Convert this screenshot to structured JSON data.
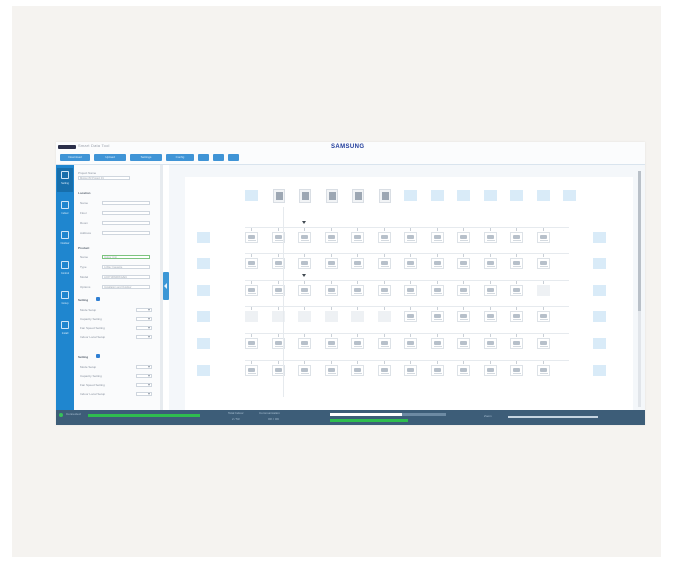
{
  "header": {
    "logo_text": "Smart Data Tool",
    "brand": "SAMSUNG",
    "toolbar": [
      {
        "label": "Download",
        "w": 30
      },
      {
        "label": "Upload",
        "w": 32
      },
      {
        "label": "Settings",
        "w": 32
      },
      {
        "label": "Config",
        "w": 28
      },
      {
        "label": "",
        "w": 11
      },
      {
        "label": "",
        "w": 11
      },
      {
        "label": "",
        "w": 11
      }
    ]
  },
  "nav": {
    "items": [
      {
        "label": "Setting"
      },
      {
        "label": "Indoor"
      },
      {
        "label": "Outdoor"
      },
      {
        "label": "Control"
      },
      {
        "label": "Group"
      },
      {
        "label": "Install"
      }
    ]
  },
  "panel": {
    "project_label": "Project Name",
    "project_value": "Motion 83 Project 01",
    "location_header": "Location",
    "location_fields": [
      "Name",
      "Floor",
      "Room",
      "Address"
    ],
    "product_header": "Product",
    "product_fields": [
      {
        "label": "Name",
        "value": "Indoor Unit"
      },
      {
        "label": "Type",
        "value": "4-Way Cassette"
      },
      {
        "label": "Model",
        "value": "AC071RN4DKG/EU"
      },
      {
        "label": "Options",
        "value": "Installation and Outdoor"
      }
    ],
    "setting1_header": "Setting",
    "setting1_fields": [
      "Mode Setup",
      "Capacity Setting",
      "Fan Speed Setting",
      "Indoor Local Setup"
    ],
    "setting2_header": "Setting",
    "setting2_fields": [
      "Mode Setup",
      "Capacity Setting",
      "Fan Speed Setting",
      "Indoor Local Setup"
    ]
  },
  "status": {
    "connection": "Connected",
    "field_a_label": "Total Indoor",
    "field_a_value": "2 / 53",
    "field_b_label": "Communication",
    "field_b_value": "OK / OK",
    "label_right": "Zoom",
    "progress": 0.62
  },
  "colors": {
    "accent": "#1f86cf",
    "status_bar": "#3d5d78",
    "progress": "#2fbd4f",
    "brand": "#1e3a9a"
  }
}
